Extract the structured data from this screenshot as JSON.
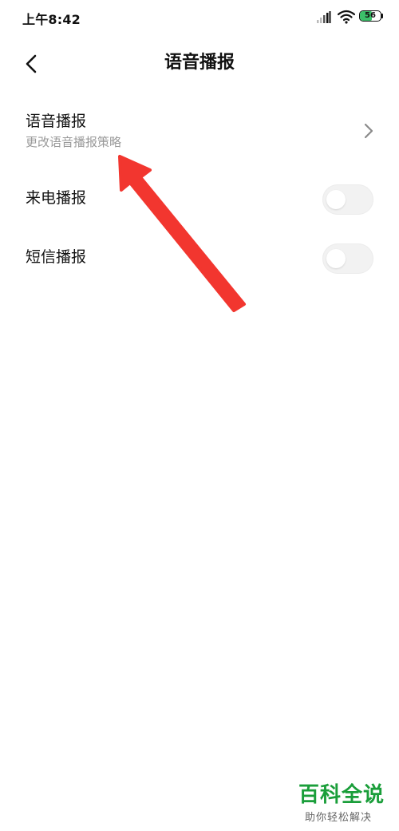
{
  "status_bar": {
    "time": "上午8:42",
    "battery_level": "56",
    "battery_percent": 56,
    "icons": [
      "signal-icon",
      "wifi-icon",
      "battery-icon"
    ]
  },
  "header": {
    "title": "语音播报",
    "back_icon": "chevron-left-icon"
  },
  "settings": {
    "items": [
      {
        "title": "语音播报",
        "subtitle": "更改语音播报策略",
        "control": "chevron-right-icon"
      },
      {
        "title": "来电播报",
        "control": "toggle",
        "enabled": false
      },
      {
        "title": "短信播报",
        "control": "toggle",
        "enabled": false
      }
    ]
  },
  "annotation": {
    "type": "arrow",
    "color": "#f2362f"
  },
  "watermark": {
    "brand": "百科全说",
    "slogan": "助你轻松解决",
    "color": "#1a9e3a"
  }
}
